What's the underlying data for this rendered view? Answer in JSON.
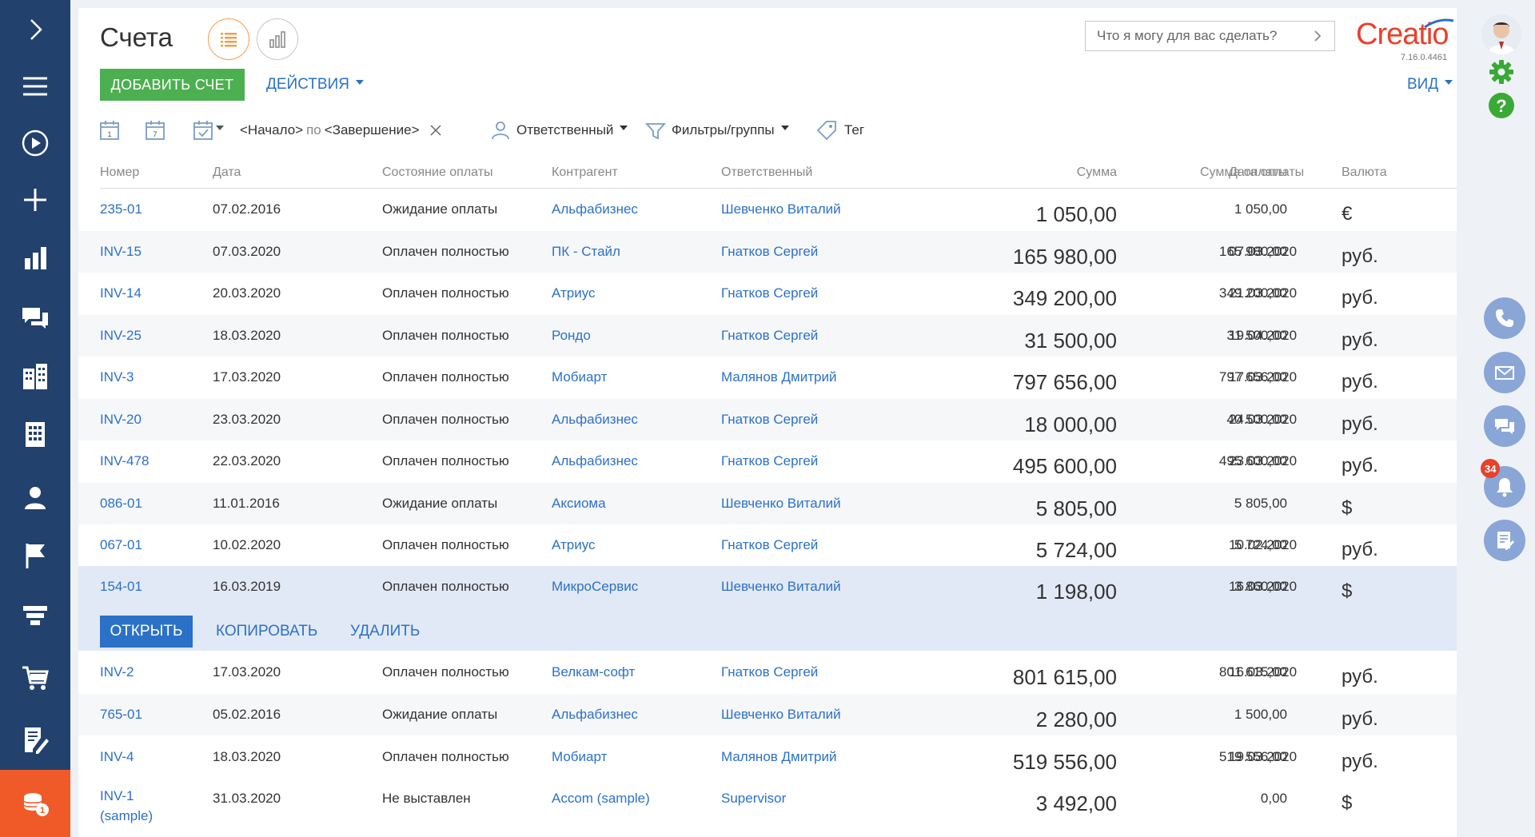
{
  "header": {
    "title": "Счета",
    "search_placeholder": "Что я могу для вас сделать?",
    "logo": "Creatio",
    "version": "7.16.0.4461"
  },
  "toolbar": {
    "add_label": "ДОБАВИТЬ СЧЕТ",
    "actions_label": "ДЕЙСТВИЯ",
    "view_label": "ВИД"
  },
  "filters": {
    "period_start": "<Начало>",
    "period_by": "по",
    "period_end": "<Завершение>",
    "owner": "Ответственный",
    "groups": "Фильтры/группы",
    "tag": "Тег"
  },
  "columns": {
    "number": "Номер",
    "date": "Дата",
    "payment_status": "Состояние оплаты",
    "account": "Контрагент",
    "owner": "Ответственный",
    "amount": "Сумма",
    "paid_amount": "Сумма оплаты",
    "payment_date": "Дата оплаты",
    "currency": "Валюта"
  },
  "rows": [
    {
      "number": "235-01",
      "date": "07.02.2016",
      "status": "Ожидание оплаты",
      "account": "Альфабизнес",
      "owner": "Шевченко Виталий",
      "amount": "1 050,00",
      "paid": "1 050,00",
      "paid_date": "",
      "currency": "€"
    },
    {
      "number": "INV-15",
      "date": "07.03.2020",
      "status": "Оплачен полностью",
      "account": "ПК - Стайл",
      "owner": "Гнатков Сергей",
      "amount": "165 980,00",
      "paid": "165 980,00",
      "paid_date": "07.03.2020",
      "currency": "руб."
    },
    {
      "number": "INV-14",
      "date": "20.03.2020",
      "status": "Оплачен полностью",
      "account": "Атриус",
      "owner": "Гнатков Сергей",
      "amount": "349 200,00",
      "paid": "349 200,00",
      "paid_date": "21.03.2020",
      "currency": "руб."
    },
    {
      "number": "INV-25",
      "date": "18.03.2020",
      "status": "Оплачен полностью",
      "account": "Рондо",
      "owner": "Гнатков Сергей",
      "amount": "31 500,00",
      "paid": "31 500,00",
      "paid_date": "19.04.2020",
      "currency": "руб."
    },
    {
      "number": "INV-3",
      "date": "17.03.2020",
      "status": "Оплачен полностью",
      "account": "Мобиарт",
      "owner": "Малянов Дмитрий",
      "amount": "797 656,00",
      "paid": "797 656,00",
      "paid_date": "17.03.2020",
      "currency": "руб."
    },
    {
      "number": "INV-20",
      "date": "23.03.2020",
      "status": "Оплачен полностью",
      "account": "Альфабизнес",
      "owner": "Гнатков Сергей",
      "amount": "18 000,00",
      "paid": "40 500,00",
      "paid_date": "24.03.2020",
      "currency": "руб."
    },
    {
      "number": "INV-478",
      "date": "22.03.2020",
      "status": "Оплачен полностью",
      "account": "Альфабизнес",
      "owner": "Гнатков Сергей",
      "amount": "495 600,00",
      "paid": "495 600,00",
      "paid_date": "23.03.2020",
      "currency": "руб."
    },
    {
      "number": "086-01",
      "date": "11.01.2016",
      "status": "Ожидание оплаты",
      "account": "Аксиома",
      "owner": "Шевченко Виталий",
      "amount": "5 805,00",
      "paid": "5 805,00",
      "paid_date": "",
      "currency": "$"
    },
    {
      "number": "067-01",
      "date": "10.02.2020",
      "status": "Оплачен полностью",
      "account": "Атриус",
      "owner": "Гнатков Сергей",
      "amount": "5 724,00",
      "paid": "5 724,00",
      "paid_date": "10.02.2020",
      "currency": "руб."
    },
    {
      "number": "154-01",
      "date": "16.03.2019",
      "status": "Оплачен полностью",
      "account": "МикроСервис",
      "owner": "Шевченко Виталий",
      "amount": "1 198,00",
      "paid": "3 860,00",
      "paid_date": "16.03.2020",
      "currency": "$"
    },
    {
      "number": "INV-2",
      "date": "17.03.2020",
      "status": "Оплачен полностью",
      "account": "Велкам-софт",
      "owner": "Гнатков Сергей",
      "amount": "801 615,00",
      "paid": "801 615,00",
      "paid_date": "16.03.2020",
      "currency": "руб."
    },
    {
      "number": "765-01",
      "date": "05.02.2016",
      "status": "Ожидание оплаты",
      "account": "Альфабизнес",
      "owner": "Шевченко Виталий",
      "amount": "2 280,00",
      "paid": "1 500,00",
      "paid_date": "",
      "currency": "руб."
    },
    {
      "number": "INV-4",
      "date": "18.03.2020",
      "status": "Оплачен полностью",
      "account": "Мобиарт",
      "owner": "Малянов Дмитрий",
      "amount": "519 556,00",
      "paid": "519 556,00",
      "paid_date": "19.03.2020",
      "currency": "руб."
    },
    {
      "number": "INV-1 (sample)",
      "date": "31.03.2020",
      "status": "Не выставлен",
      "account": "Accom (sample)",
      "owner": "Supervisor",
      "amount": "3 492,00",
      "paid": "0,00",
      "paid_date": "",
      "currency": "$"
    }
  ],
  "row_actions": {
    "open": "ОТКРЫТЬ",
    "copy": "КОПИРОВАТЬ",
    "delete": "УДАЛИТЬ"
  },
  "notifications": {
    "count": "34"
  },
  "colors": {
    "sidebar": "#22416c",
    "accent_orange": "#f05a28",
    "link_blue": "#2b71c7",
    "add_green": "#4caf50"
  }
}
